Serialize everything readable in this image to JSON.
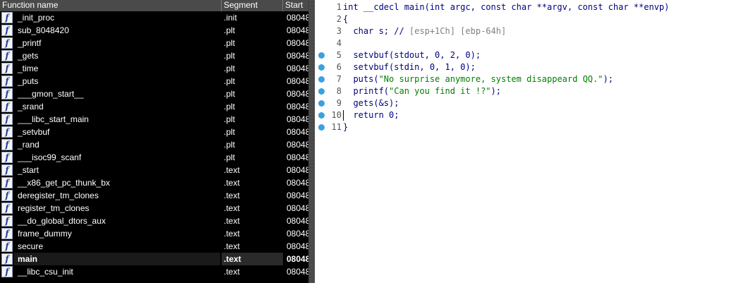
{
  "functions_window": {
    "columns": {
      "name": "Function name",
      "segment": "Segment",
      "start": "Start"
    },
    "rows": [
      {
        "name": "_init_proc",
        "segment": ".init",
        "start": "08048"
      },
      {
        "name": "sub_8048420",
        "segment": ".plt",
        "start": "08048"
      },
      {
        "name": "_printf",
        "segment": ".plt",
        "start": "08048"
      },
      {
        "name": "_gets",
        "segment": ".plt",
        "start": "08048"
      },
      {
        "name": "_time",
        "segment": ".plt",
        "start": "08048"
      },
      {
        "name": "_puts",
        "segment": ".plt",
        "start": "08048"
      },
      {
        "name": "___gmon_start__",
        "segment": ".plt",
        "start": "08048"
      },
      {
        "name": "_srand",
        "segment": ".plt",
        "start": "08048"
      },
      {
        "name": "___libc_start_main",
        "segment": ".plt",
        "start": "08048"
      },
      {
        "name": "_setvbuf",
        "segment": ".plt",
        "start": "08048"
      },
      {
        "name": "_rand",
        "segment": ".plt",
        "start": "08048"
      },
      {
        "name": "___isoc99_scanf",
        "segment": ".plt",
        "start": "08048"
      },
      {
        "name": "_start",
        "segment": ".text",
        "start": "08048"
      },
      {
        "name": "__x86_get_pc_thunk_bx",
        "segment": ".text",
        "start": "08048"
      },
      {
        "name": "deregister_tm_clones",
        "segment": ".text",
        "start": "08048"
      },
      {
        "name": "register_tm_clones",
        "segment": ".text",
        "start": "08048"
      },
      {
        "name": "__do_global_dtors_aux",
        "segment": ".text",
        "start": "08048"
      },
      {
        "name": "frame_dummy",
        "segment": ".text",
        "start": "08048"
      },
      {
        "name": "secure",
        "segment": ".text",
        "start": "08048"
      },
      {
        "name": "main",
        "segment": ".text",
        "start": "08048",
        "selected": true
      },
      {
        "name": "__libc_csu_init",
        "segment": ".text",
        "start": "08048"
      }
    ],
    "icon": "function-icon"
  },
  "pseudocode": {
    "lines": [
      {
        "num": "1",
        "code": "int __cdecl main(int argc, const char **argv, const char **envp)",
        "dot": false
      },
      {
        "num": "2",
        "code": "{",
        "dot": false
      },
      {
        "num": "3",
        "code": "  char s; // ",
        "comment": "[esp+1Ch] [ebp-64h]",
        "dot": false
      },
      {
        "num": "4",
        "code": "",
        "dot": false
      },
      {
        "num": "5",
        "code": "  setvbuf(stdout, 0, 2, 0);",
        "dot": true
      },
      {
        "num": "6",
        "code": "  setvbuf(stdin, 0, 1, 0);",
        "dot": true
      },
      {
        "num": "7",
        "code": "  puts(",
        "string": "\"No surprise anymore, system disappeard QQ.\"",
        "tail": ");",
        "dot": true
      },
      {
        "num": "8",
        "code": "  printf(",
        "string": "\"Can you find it !?\"",
        "tail": ");",
        "dot": true
      },
      {
        "num": "9",
        "code": "  gets(&s);",
        "dot": true
      },
      {
        "num": "10",
        "code": "  return 0;",
        "dot": true,
        "caret": true
      },
      {
        "num": "11",
        "code": "}",
        "dot": true
      }
    ]
  },
  "colors": {
    "accent_dot": "#3aa0e0",
    "code_text": "#000080",
    "string": "#008000",
    "comment": "#808080"
  }
}
